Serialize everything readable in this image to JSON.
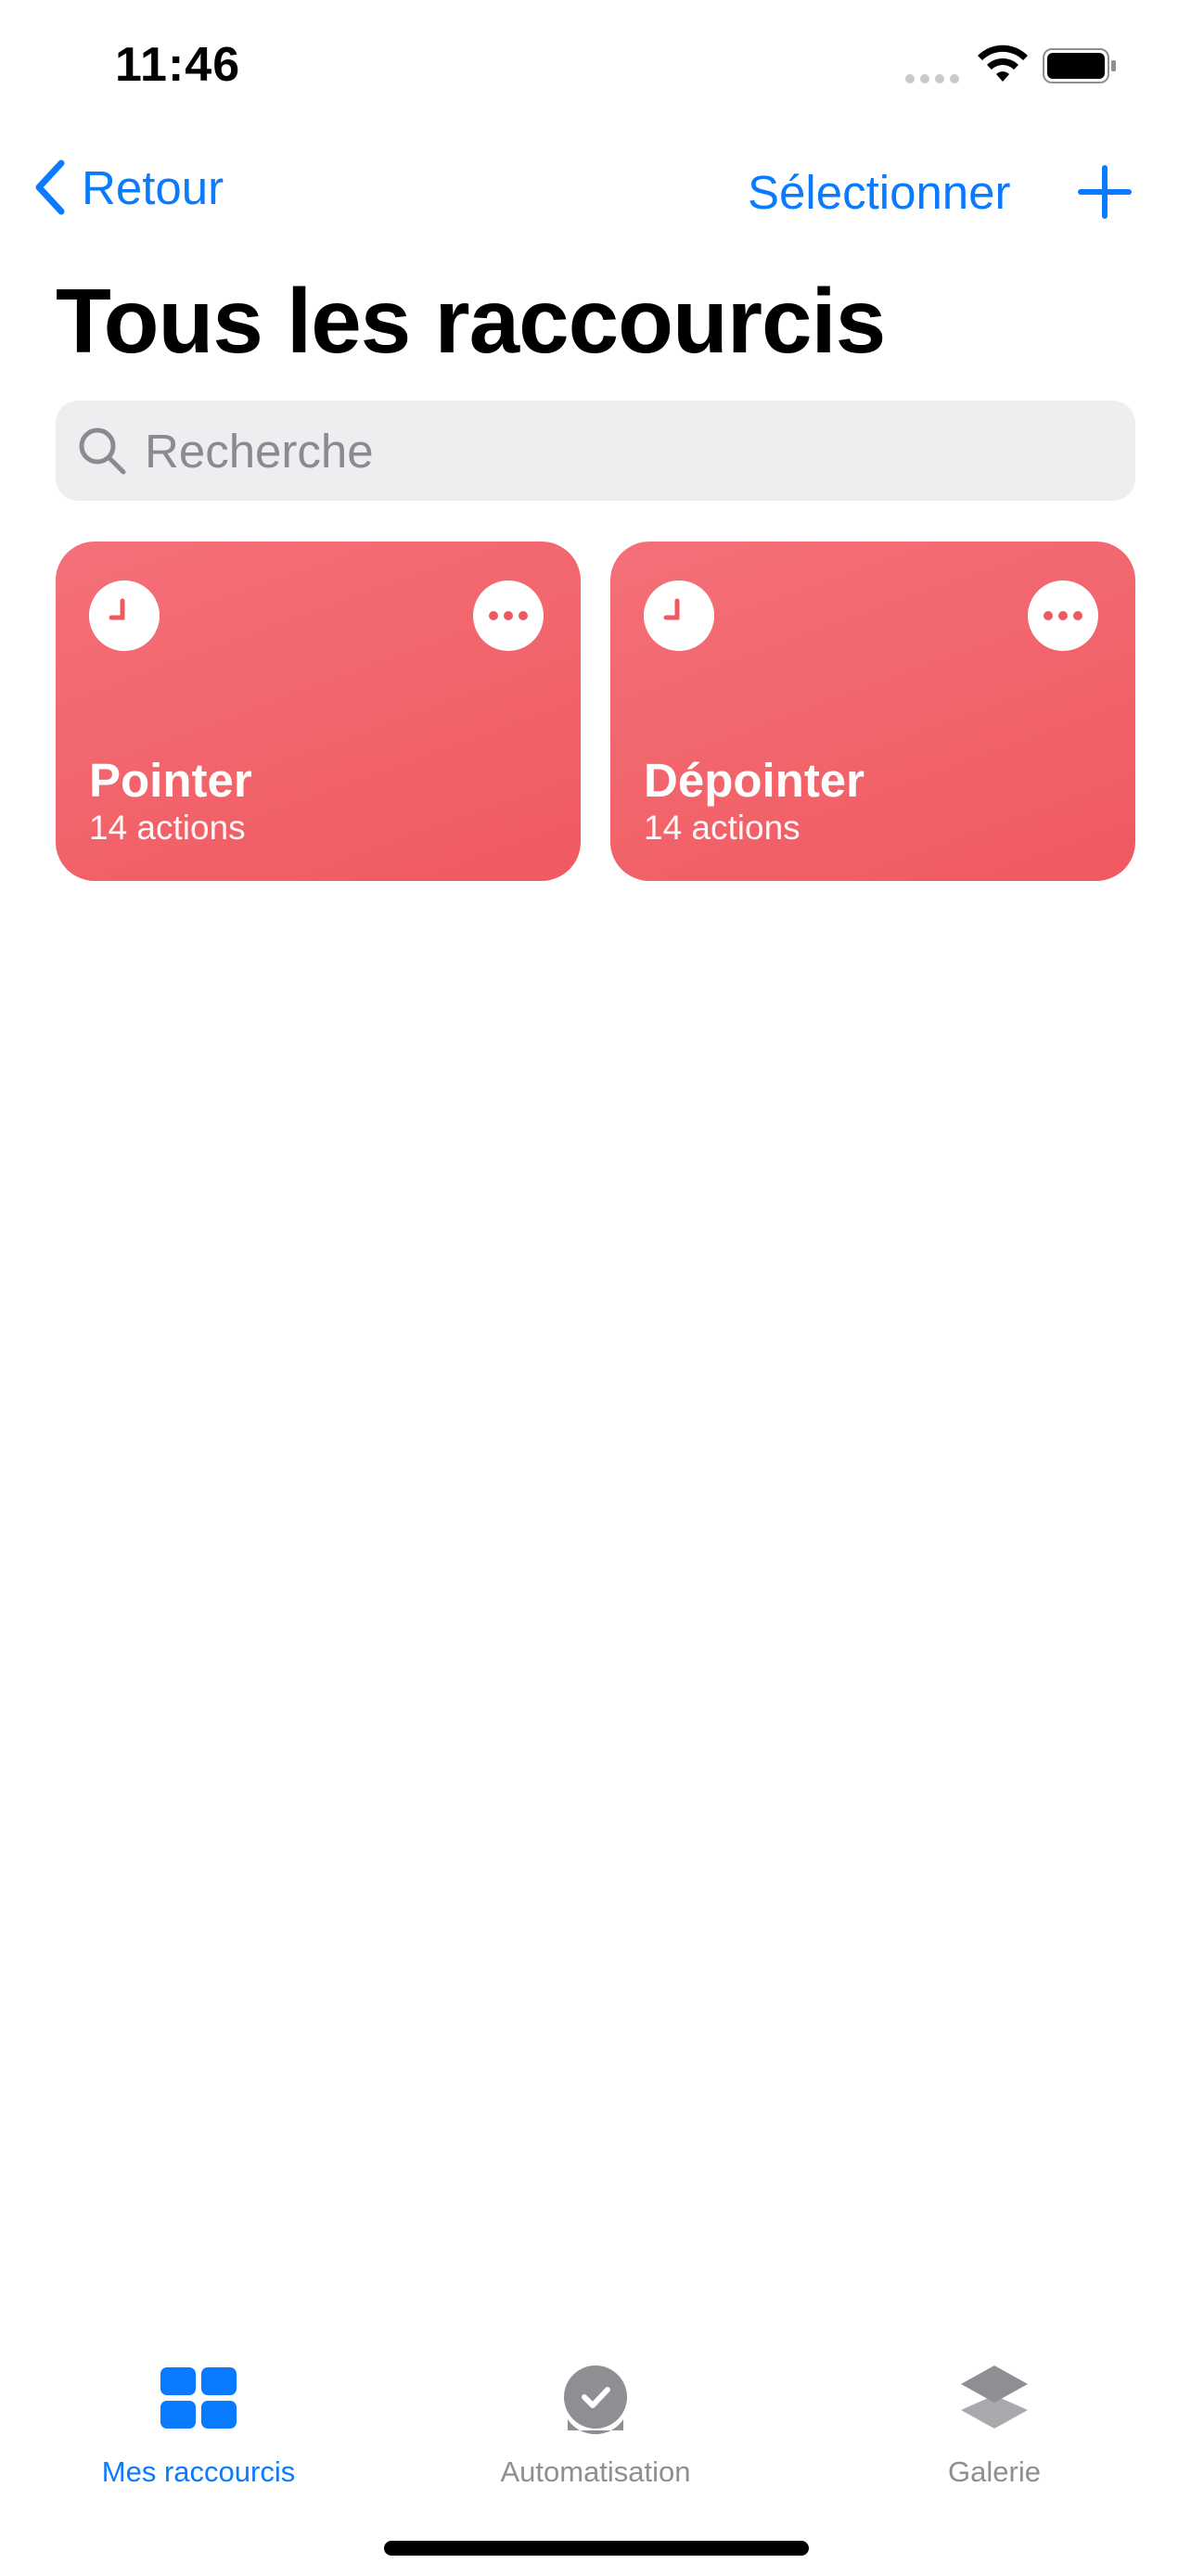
{
  "status_bar": {
    "time": "11:46"
  },
  "nav": {
    "back_label": "Retour",
    "select_label": "Sélectionner"
  },
  "title": "Tous les raccourcis",
  "search": {
    "placeholder": "Recherche"
  },
  "shortcuts": [
    {
      "name": "Pointer",
      "subtitle": "14 actions",
      "icon": "clock-icon",
      "color": "#f0595f"
    },
    {
      "name": "Dépointer",
      "subtitle": "14 actions",
      "icon": "clock-icon",
      "color": "#f0595f"
    }
  ],
  "tabs": [
    {
      "label": "Mes raccourcis",
      "icon": "grid-icon",
      "selected": true,
      "color": "#0a7aff"
    },
    {
      "label": "Automatisation",
      "icon": "automation-check-icon",
      "selected": false,
      "color": "#8e8e93"
    },
    {
      "label": "Galerie",
      "icon": "layers-icon",
      "selected": false,
      "color": "#8e8e93"
    }
  ],
  "colors": {
    "accent": "#0a7aff",
    "tile": "#f0595f"
  }
}
